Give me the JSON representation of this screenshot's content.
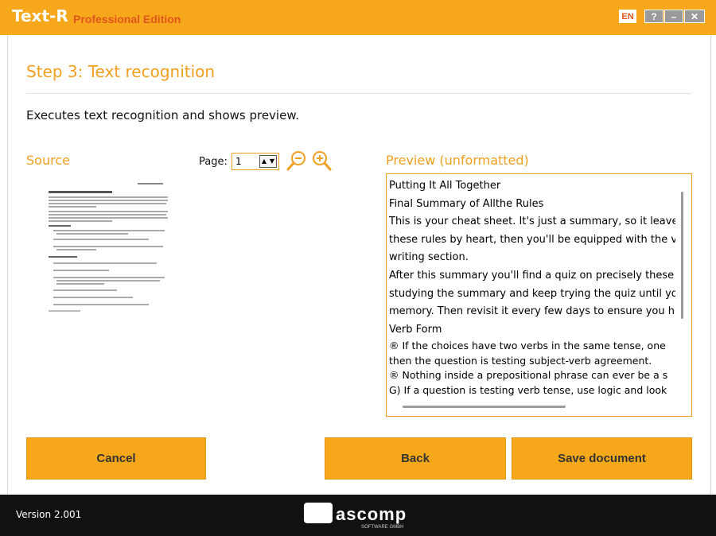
{
  "titlebar": {
    "app_name": "Text-",
    "app_name_r": "R",
    "edition": "Professional Edition",
    "lang": "EN",
    "help": "?",
    "minimize": "–",
    "close": "✕"
  },
  "step": {
    "title": "Step 3: Text recognition",
    "description": "Executes text recognition and shows preview."
  },
  "source": {
    "label": "Source",
    "page_label": "Page:",
    "page_value": "1",
    "zoom_out_icon": "zoom-out-icon",
    "zoom_in_icon": "zoom-in-icon"
  },
  "preview": {
    "label": "Preview (unformatted)",
    "lines": [
      "Putting It All Together",
      "Final Summary of Allthe Rules",
      "This is your cheat sheet. It's just a summary, so it leave",
      "these rules by heart, then you'll be equipped with the va",
      "writing section.",
      "After this summary you'll find a quiz on precisely these",
      "studying the summary and keep trying the quiz until you",
      "memory. Then revisit it every few days to ensure you h",
      "Verb Form",
      "® If the choices have two verbs in the same tense, one",
      "then the question is testing subject-verb agreement.",
      "® Nothing inside a prepositional phrase can ever be a s",
      "G) If a question is testing verb tense, use logic and look"
    ]
  },
  "buttons": {
    "cancel": "Cancel",
    "back": "Back",
    "save": "Save document"
  },
  "footer": {
    "version": "Version 2.001",
    "logo_text": "ascomp",
    "logo_sub": "SOFTWARE GMBH"
  },
  "colors": {
    "accent": "#f6a81a",
    "heading": "#f0a020",
    "edition": "#e0561c",
    "footer": "#111111"
  }
}
